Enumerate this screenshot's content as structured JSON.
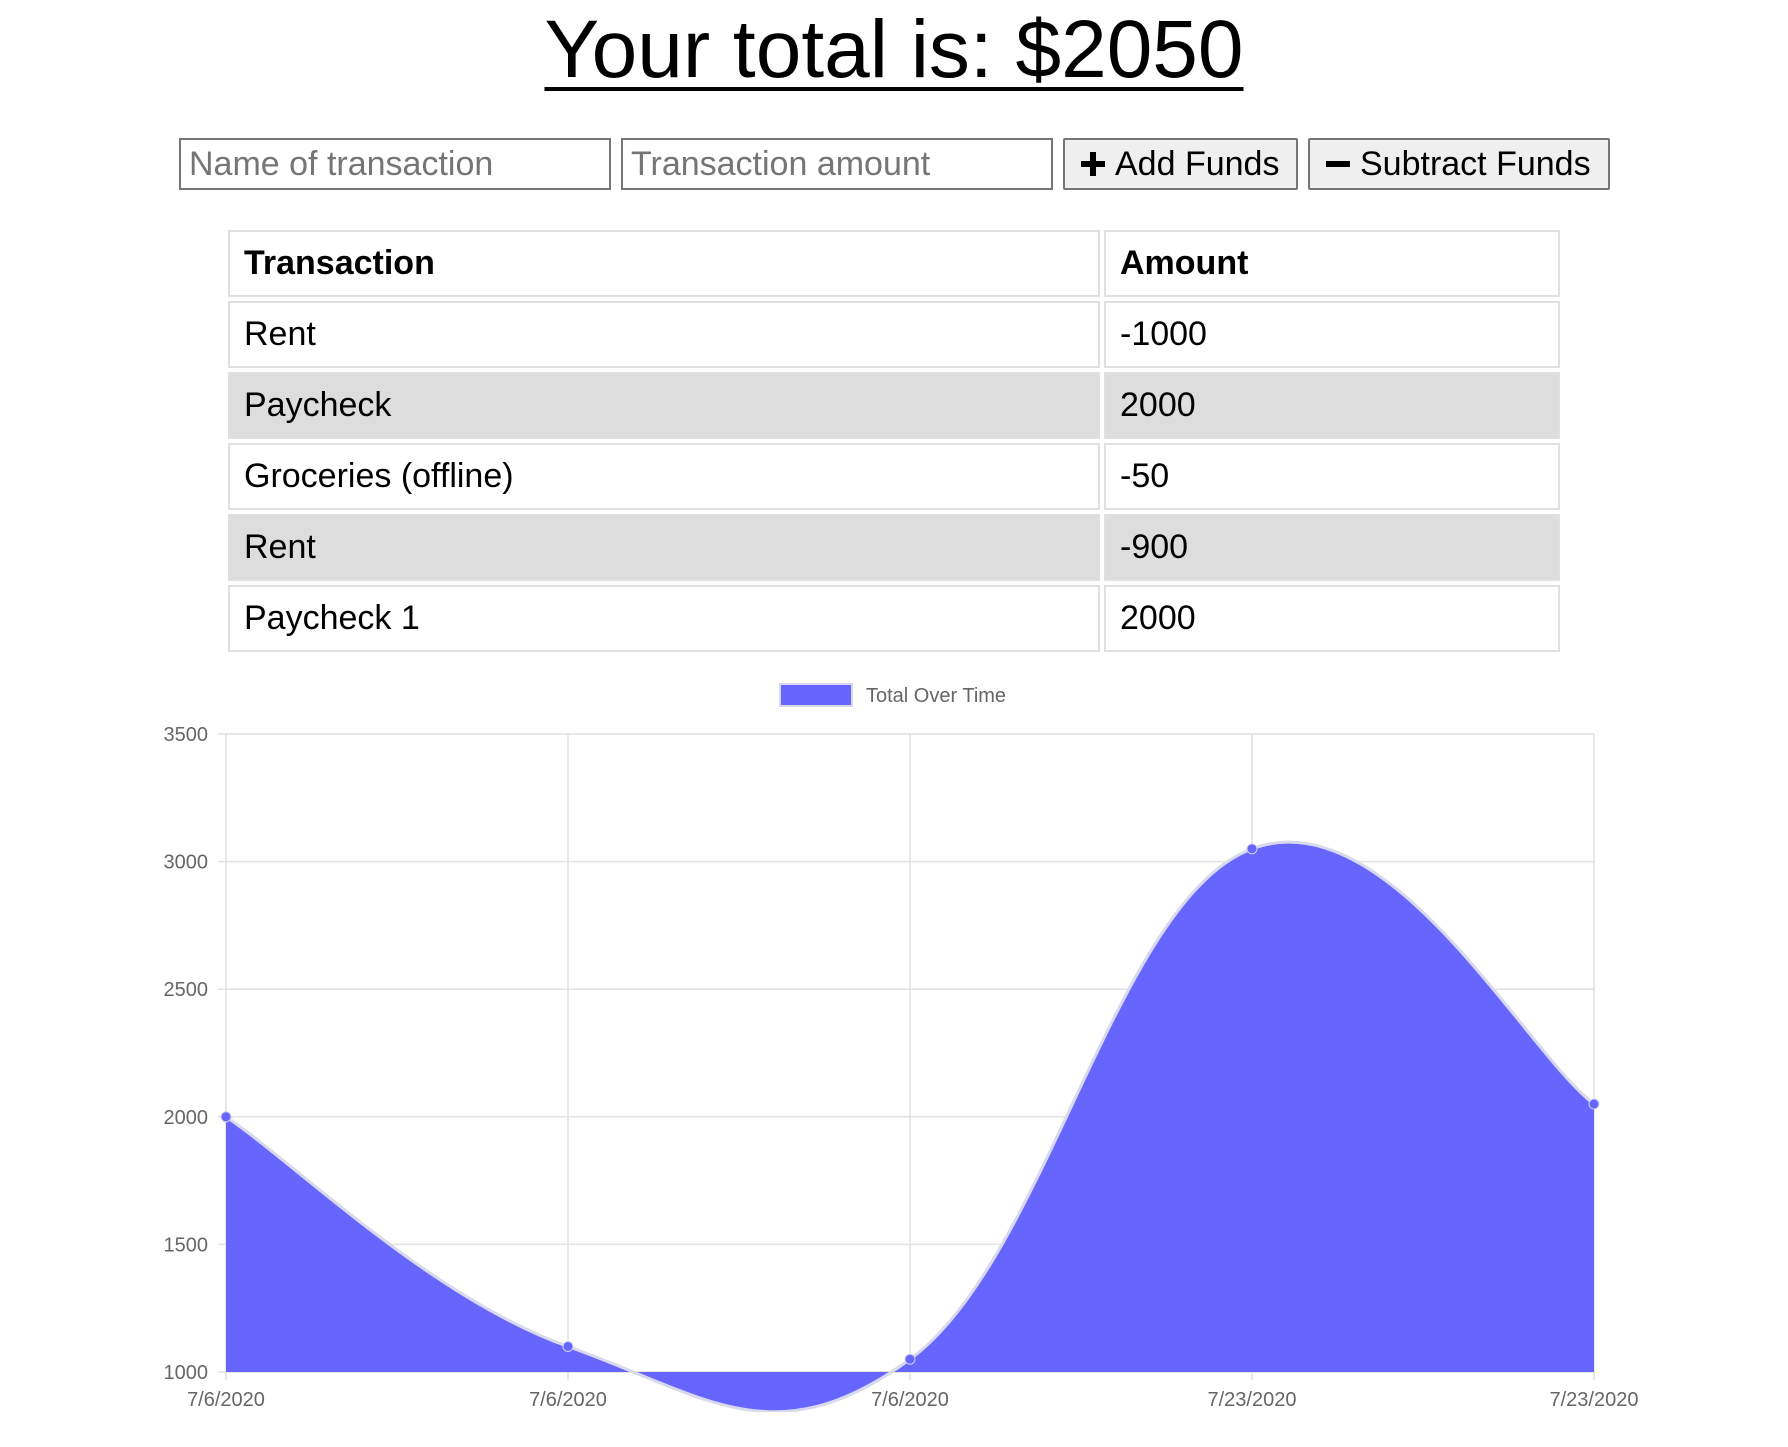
{
  "header": {
    "total_text": "Your total is: $2050"
  },
  "form": {
    "name_placeholder": "Name of transaction",
    "amount_placeholder": "Transaction amount",
    "add_label": "Add Funds",
    "subtract_label": "Subtract Funds"
  },
  "table": {
    "headers": [
      "Transaction",
      "Amount"
    ],
    "rows": [
      {
        "name": "Rent",
        "amount": "-1000"
      },
      {
        "name": "Paycheck",
        "amount": "2000"
      },
      {
        "name": "Groceries (offline)",
        "amount": "-50"
      },
      {
        "name": "Rent",
        "amount": "-900"
      },
      {
        "name": "Paycheck 1",
        "amount": "2000"
      }
    ]
  },
  "chart_data": {
    "type": "area",
    "x": [
      "7/6/2020",
      "7/6/2020",
      "7/6/2020",
      "7/23/2020",
      "7/23/2020"
    ],
    "series": [
      {
        "name": "Total Over Time",
        "values": [
          2000,
          1100,
          1050,
          3050,
          2050
        ],
        "color": "#6666ff"
      }
    ],
    "ylim": [
      1000,
      3500
    ],
    "yticks": [
      1000,
      1500,
      2000,
      2500,
      3000,
      3500
    ],
    "grid": true,
    "legend_position": "top"
  }
}
